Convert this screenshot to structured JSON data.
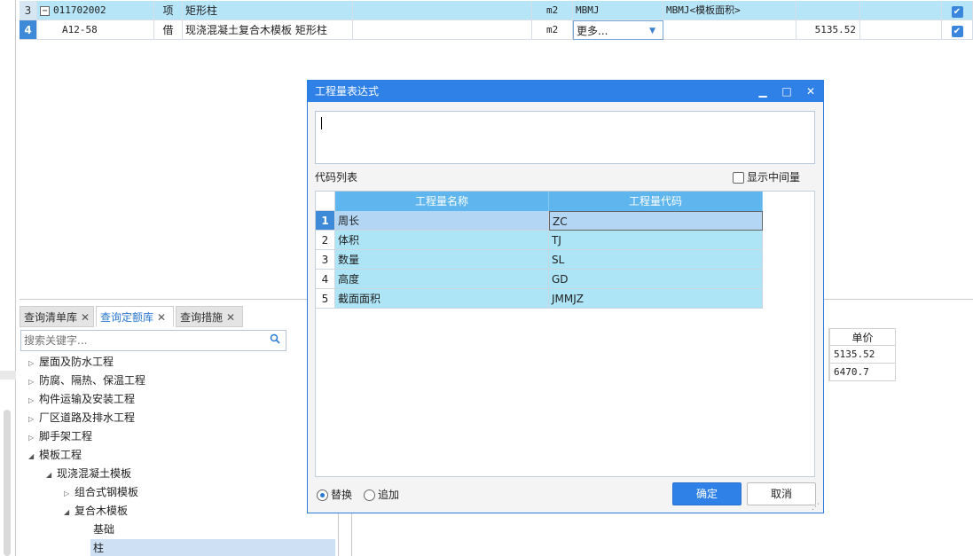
{
  "grid": {
    "rows": [
      {
        "num": "3",
        "code": "011702002",
        "type": "项",
        "name": "矩形柱",
        "unit": "m2",
        "expr": "MBMJ",
        "expr_desc": "MBMJ<模板面积>",
        "price": "",
        "checked": "✔"
      },
      {
        "num": "4",
        "code": "A12-58",
        "type": "借",
        "name": "现浇混凝土复合木模板 矩形柱",
        "unit": "m2",
        "expr": "更多...",
        "expr_desc": "",
        "price": "5135.52",
        "checked": "✔"
      }
    ],
    "collapse_glyph": "−"
  },
  "tabs": [
    {
      "label": "查询清单库",
      "close": "✕"
    },
    {
      "label": "查询定额库",
      "close": "✕"
    },
    {
      "label": "查询措施",
      "close": "✕"
    }
  ],
  "search": {
    "placeholder": "搜索关键字...",
    "icon": "search-icon"
  },
  "tree": [
    {
      "label": "屋面及防水工程",
      "arrow": "▷"
    },
    {
      "label": "防腐、隔热、保温工程",
      "arrow": "▷"
    },
    {
      "label": "构件运输及安装工程",
      "arrow": "▷"
    },
    {
      "label": "厂区道路及排水工程",
      "arrow": "▷"
    },
    {
      "label": "脚手架工程",
      "arrow": "▷"
    },
    {
      "label": "模板工程",
      "arrow": "◢"
    },
    {
      "label": "现浇混凝土模板",
      "arrow": "◢"
    },
    {
      "label": "组合式钢模板",
      "arrow": "▷"
    },
    {
      "label": "复合木模板",
      "arrow": "◢"
    },
    {
      "label": "基础",
      "arrow": ""
    },
    {
      "label": "柱",
      "arrow": ""
    }
  ],
  "price_table": {
    "header": "单价",
    "values": [
      "5135.52",
      "6470.7"
    ]
  },
  "dialog": {
    "title": "工程量表达式",
    "minimize": "▁",
    "maximize": "□",
    "close": "✕",
    "expression_value": "",
    "code_list_label": "代码列表",
    "show_intermediate_label": "显示中间量",
    "columns": [
      "工程量名称",
      "工程量代码"
    ],
    "rows": [
      {
        "num": "1",
        "name": "周长",
        "code": "ZC"
      },
      {
        "num": "2",
        "name": "体积",
        "code": "TJ"
      },
      {
        "num": "3",
        "name": "数量",
        "code": "SL"
      },
      {
        "num": "4",
        "name": "高度",
        "code": "GD"
      },
      {
        "num": "5",
        "name": "截面面积",
        "code": "JMMJZ"
      }
    ],
    "option_replace": "替换",
    "option_append": "追加",
    "ok_label": "确定",
    "cancel_label": "取消"
  }
}
